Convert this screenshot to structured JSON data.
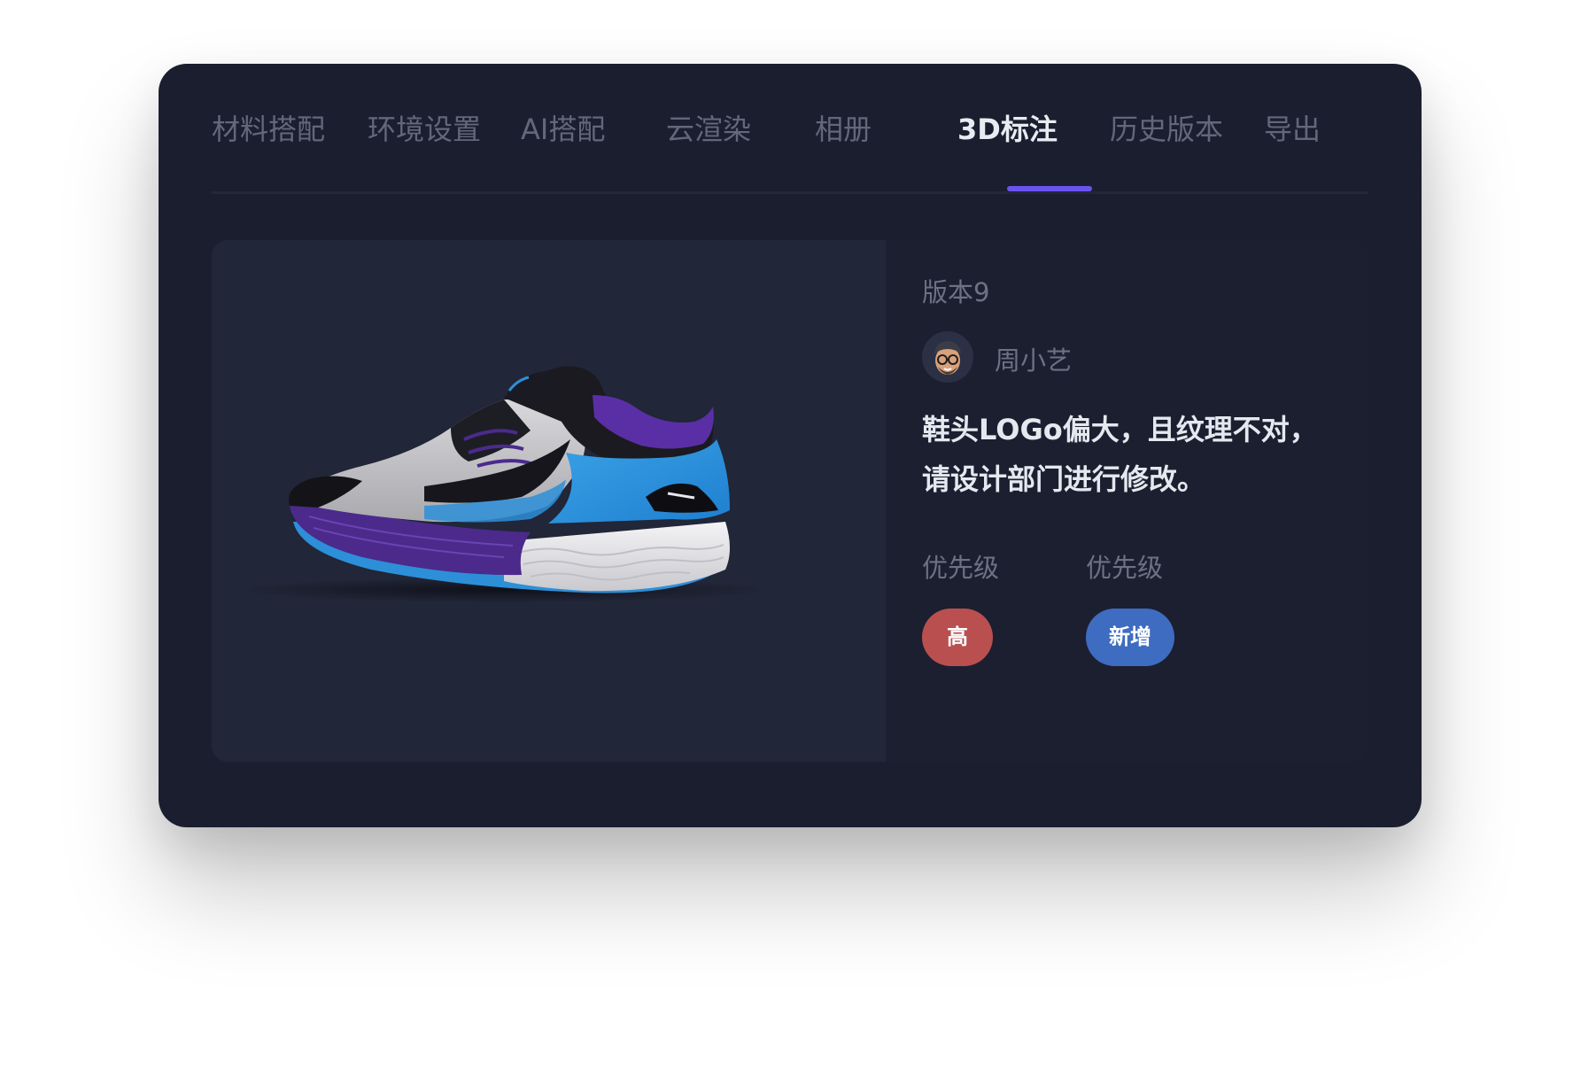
{
  "tabs": [
    {
      "label": "材料搭配"
    },
    {
      "label": "环境设置"
    },
    {
      "label": "AI搭配"
    },
    {
      "label": "云渲染"
    },
    {
      "label": "相册"
    },
    {
      "label": "3D标注"
    },
    {
      "label": "历史版本"
    },
    {
      "label": "导出"
    }
  ],
  "active_tab": "3D标注",
  "annotation": {
    "version": "版本9",
    "author": "周小艺",
    "comment_line1": "鞋头LOGo偏大，且纹理不对，",
    "comment_line2": "请设计部门进行修改。",
    "priority_label_1": "优先级",
    "priority_label_2": "优先级",
    "priority_value": "高",
    "status_value": "新增"
  },
  "colors": {
    "accent": "#6a54f0",
    "priority_high": "#b9504f",
    "status_new": "#3e6cc0",
    "window_bg": "#1b1e2f",
    "viewer_bg": "#212638"
  },
  "icons": {
    "avatar": "memoji-avatar",
    "product": "running-shoe-3d-model"
  }
}
